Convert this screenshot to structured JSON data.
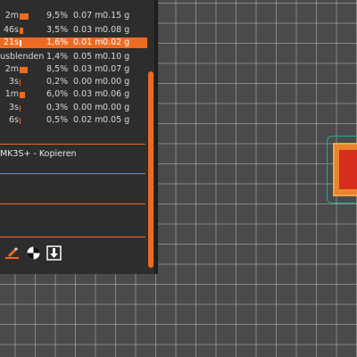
{
  "stats": {
    "rows": [
      {
        "time": "2m",
        "bar_fraction": 0.38,
        "percent": "9,5%",
        "length": "0.07 m",
        "weight": "0.15 g",
        "highlighted": false
      },
      {
        "time": "46s",
        "bar_fraction": 0.15,
        "percent": "3,5%",
        "length": "0.03 m",
        "weight": "0.08 g",
        "highlighted": false
      },
      {
        "time": "21s",
        "bar_fraction": 0.07,
        "percent": "1,6%",
        "length": "0.01 m",
        "weight": "0.02 g",
        "highlighted": true
      },
      {
        "time": "usblenden",
        "bar_fraction": 0,
        "percent": "1,4%",
        "length": "0.05 m",
        "weight": "0.10 g",
        "highlighted": false
      },
      {
        "time": "2m",
        "bar_fraction": 0.34,
        "percent": "8,5%",
        "length": "0.03 m",
        "weight": "0.07 g",
        "highlighted": false
      },
      {
        "time": "3s",
        "bar_fraction": 0.03,
        "percent": "0,2%",
        "length": "0.00 m",
        "weight": "0.00 g",
        "highlighted": false
      },
      {
        "time": "1m",
        "bar_fraction": 0.24,
        "percent": "6,0%",
        "length": "0.03 m",
        "weight": "0.06 g",
        "highlighted": false
      },
      {
        "time": "3s",
        "bar_fraction": 0.03,
        "percent": "0,3%",
        "length": "0.00 m",
        "weight": "0.00 g",
        "highlighted": false
      },
      {
        "time": "6s",
        "bar_fraction": 0.05,
        "percent": "0,5%",
        "length": "0.02 m",
        "weight": "0.05 g",
        "highlighted": false
      }
    ]
  },
  "printer_label": "MK3S+ - Kopieren",
  "icons": [
    "edit-icon",
    "color-change-icon",
    "export-icon"
  ],
  "colors": {
    "accent": "#ed6b21",
    "panel": "#2d2d2d",
    "bed": "#4a4a4c",
    "outline": "#1fae86"
  }
}
